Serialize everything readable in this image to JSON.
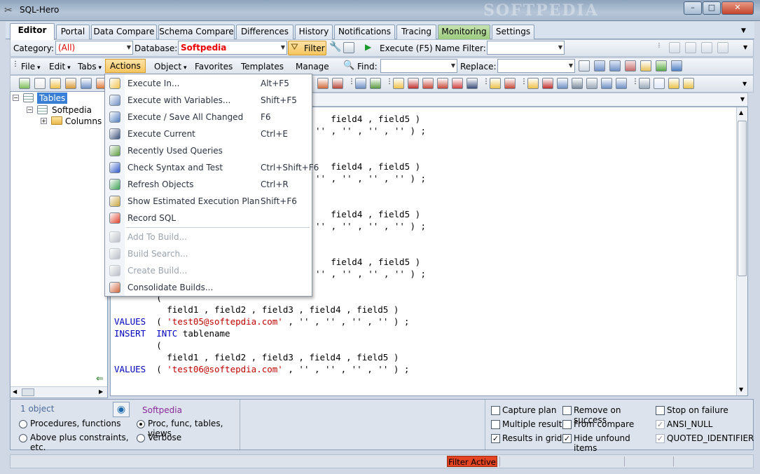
{
  "window": {
    "title": "SQL-Hero",
    "watermark": "SOFTPEDIA",
    "controls": {
      "minimize": "–",
      "maximize": "□",
      "close": "✕"
    }
  },
  "tabs": [
    {
      "label": "Editor",
      "active": true
    },
    {
      "label": "Portal"
    },
    {
      "label": "Data Compare"
    },
    {
      "label": "Schema Compare"
    },
    {
      "label": "Differences"
    },
    {
      "label": "History"
    },
    {
      "label": "Notifications"
    },
    {
      "label": "Tracing"
    },
    {
      "label": "Monitoring",
      "green": true
    },
    {
      "label": "Settings"
    }
  ],
  "toolbar1": {
    "category_label": "Category:",
    "category_value": "(All)",
    "database_label": "Database:",
    "database_value": "Softpedia",
    "filter_label": "Filter",
    "execute_label": "Execute (F5)",
    "name_filter_label": "Name Filter:",
    "name_filter_value": ""
  },
  "menubar": {
    "items": [
      "File",
      "Edit",
      "Tabs",
      "Actions",
      "Object",
      "Favorites",
      "Templates",
      "Manage"
    ],
    "find_label": "Find:",
    "replace_label": "Replace:"
  },
  "tree": {
    "root": "Tables",
    "child": "Softpedia",
    "grandchild": "Columns"
  },
  "actions_menu": [
    {
      "label": "Execute In...",
      "shortcut": "Alt+F5",
      "icon": "execute-in-icon",
      "color": "#f0c24a"
    },
    {
      "label": "Execute with Variables...",
      "shortcut": "Shift+F5",
      "icon": "execute-variables-icon",
      "color": "#6d8fc4"
    },
    {
      "label": "Execute / Save All Changed",
      "shortcut": "F6",
      "icon": "execute-save-icon",
      "color": "#4f7ec0"
    },
    {
      "label": "Execute Current",
      "shortcut": "Ctrl+E",
      "icon": "execute-current-icon",
      "color": "#3a4e7a"
    },
    {
      "label": "Recently Used Queries",
      "shortcut": "",
      "icon": "recent-queries-icon",
      "color": "#5a9a3e"
    },
    {
      "label": "Check Syntax and Test",
      "shortcut": "Ctrl+Shift+F6",
      "icon": "check-syntax-icon",
      "color": "#2d57c7"
    },
    {
      "label": "Refresh Objects",
      "shortcut": "Ctrl+R",
      "icon": "refresh-objects-icon",
      "color": "#3aa050"
    },
    {
      "label": "Show Estimated Execution Plan",
      "shortcut": "Shift+F6",
      "icon": "execution-plan-icon",
      "color": "#c8a43c"
    },
    {
      "label": "Record SQL",
      "shortcut": "",
      "icon": "record-icon",
      "color": "#e0402a"
    },
    {
      "label": "Add To Build...",
      "shortcut": "",
      "icon": "add-build-icon",
      "color": "#b9bec5",
      "disabled": true
    },
    {
      "label": "Build Search...",
      "shortcut": "",
      "icon": "build-search-icon",
      "color": "#b9bec5",
      "disabled": true
    },
    {
      "label": "Create Build...",
      "shortcut": "",
      "icon": "create-build-icon",
      "color": "#b9bec5",
      "disabled": true
    },
    {
      "label": "Consolidate Builds...",
      "shortcut": "",
      "icon": "consolidate-builds-icon",
      "color": "#d0643a"
    }
  ],
  "editor": {
    "lines": [
      {
        "t": "partial",
        "a": "        field4 , field5 )"
      },
      {
        "t": "tail",
        "a": "'' , '' , '' , '' ) ;"
      },
      {
        "t": "blank"
      },
      {
        "t": "blank"
      },
      {
        "t": "partial",
        "a": "        field4 , field5 )"
      },
      {
        "t": "tail",
        "a": "'' , '' , '' , '' ) ;"
      },
      {
        "t": "blank"
      },
      {
        "t": "blank"
      },
      {
        "t": "partial",
        "a": "        field4 , field5 )"
      },
      {
        "t": "tail",
        "a": "'' , '' , '' , '' ) ;"
      },
      {
        "t": "blank"
      },
      {
        "t": "blank"
      },
      {
        "t": "partial",
        "a": "        field4 , field5 )"
      },
      {
        "t": "tail",
        "a": "'' , '' , '' , '' ) ;"
      },
      {
        "t": "insert",
        "kw1": "INSERT",
        "kw2": "INTC",
        "a": " tablename"
      },
      {
        "t": "plain",
        "a": "        ("
      },
      {
        "t": "plain",
        "a": "          field1 , field2 , field3 , field4 , field5 )"
      },
      {
        "t": "values",
        "kw1": "VALUES",
        "s": "'test05@softepdia.com'",
        "a": " , '' , '' , '' , '' ) ;"
      },
      {
        "t": "insert",
        "kw1": "INSERT",
        "kw2": "INTC",
        "a": " tablename"
      },
      {
        "t": "plain",
        "a": "        ("
      },
      {
        "t": "plain",
        "a": "          field1 , field2 , field3 , field4 , field5 )"
      },
      {
        "t": "values",
        "kw1": "VALUES",
        "s": "'test06@softepdia.com'",
        "a": " , '' , '' , '' , '' ) ;"
      }
    ]
  },
  "bottom": {
    "object_count": "1 object",
    "db_name": "Softpedia",
    "radios": [
      {
        "label": "Procedures, functions",
        "on": false
      },
      {
        "label": "Above plus constraints, etc.",
        "on": false
      },
      {
        "label": "Proc, func, tables, views",
        "on": true
      },
      {
        "label": "Verbose",
        "on": false
      }
    ],
    "checks": [
      {
        "label": "Capture plan",
        "checked": false
      },
      {
        "label": "Multiple results",
        "checked": false
      },
      {
        "label": "Results in grid",
        "checked": true
      },
      {
        "label": "Remove on success",
        "checked": false
      },
      {
        "label": "From compare",
        "checked": false
      },
      {
        "label": "Hide unfound items",
        "checked": true
      },
      {
        "label": "Stop on failure",
        "checked": false
      },
      {
        "label": "ANSI_NULL",
        "checked": true,
        "disabled": true
      },
      {
        "label": "QUOTED_IDENTIFIER",
        "checked": true,
        "disabled": true
      }
    ]
  },
  "status": {
    "filter_active": "Filter Active"
  }
}
